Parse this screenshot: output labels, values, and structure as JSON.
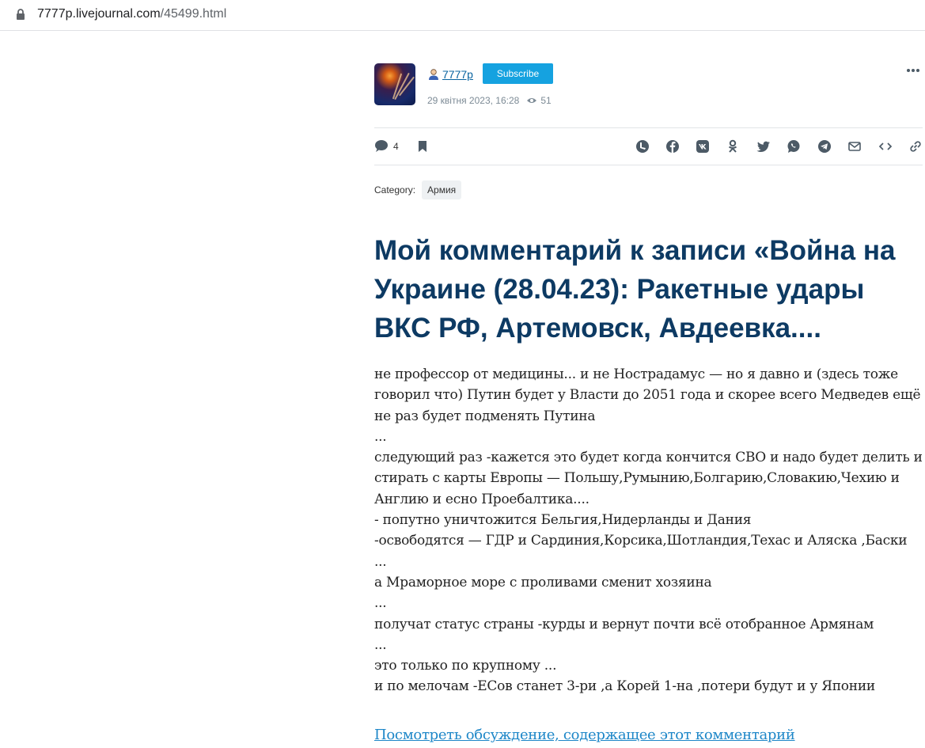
{
  "browser": {
    "url_domain": "7777p.livejournal.com",
    "url_path": "/45499.html"
  },
  "post": {
    "author": "7777p",
    "subscribe_label": "Subscribe",
    "date": "29 квітня 2023, 16:28",
    "views": "51",
    "comment_count": "4",
    "category_label": "Category:",
    "category_tag": "Армия",
    "title": "Мой комментарий к записи «Война на Украине (28.04.23): Ракетные удары ВКС РФ, Артемовск, Авдеевка....",
    "lines": [
      "не профессор от медицины... и не Нострадамус — но я давно и (здесь тоже",
      "говорил что) Путин будет у Власти до 2051 года и скорее всего Медведев ещё",
      "не раз будет подменять Путина",
      "...",
      "следующий раз -кажется это будет когда кончится СВО и надо будет делить и",
      "стирать с карты Европы — Польшу,Румынию,Болгарию,Словакию,Чехию и",
      "Англию и есно Проебалтика....",
      "- попутно уничтожится Бельгия,Нидерланды и Дания",
      "-освободятся — ГДР и Сардиния,Корсика,Шотландия,Техас и Аляска ,Баски",
      "...",
      "а Мраморное море с проливами сменит хозяина",
      "...",
      "получат статус страны -курды и вернут почти всё отобранное Армянам",
      "...",
      "это только по крупному ...",
      "и по мелочам -ЕСов станет 3-ри ,а Корей 1-на ,потери будут и у Японии"
    ],
    "discussion_link": "Посмотреть обсуждение, содержащее этот комментарий"
  },
  "share_icons": [
    "livejournal-icon",
    "facebook-icon",
    "vk-icon",
    "odnoklassniki-icon",
    "twitter-icon",
    "whatsapp-icon",
    "telegram-icon",
    "email-icon",
    "embed-code-icon",
    "copy-link-icon"
  ],
  "colors": {
    "subscribe": "#15a2e0",
    "title": "#0d3a63",
    "link": "#1e87c8",
    "icon": "#4c5a66"
  }
}
